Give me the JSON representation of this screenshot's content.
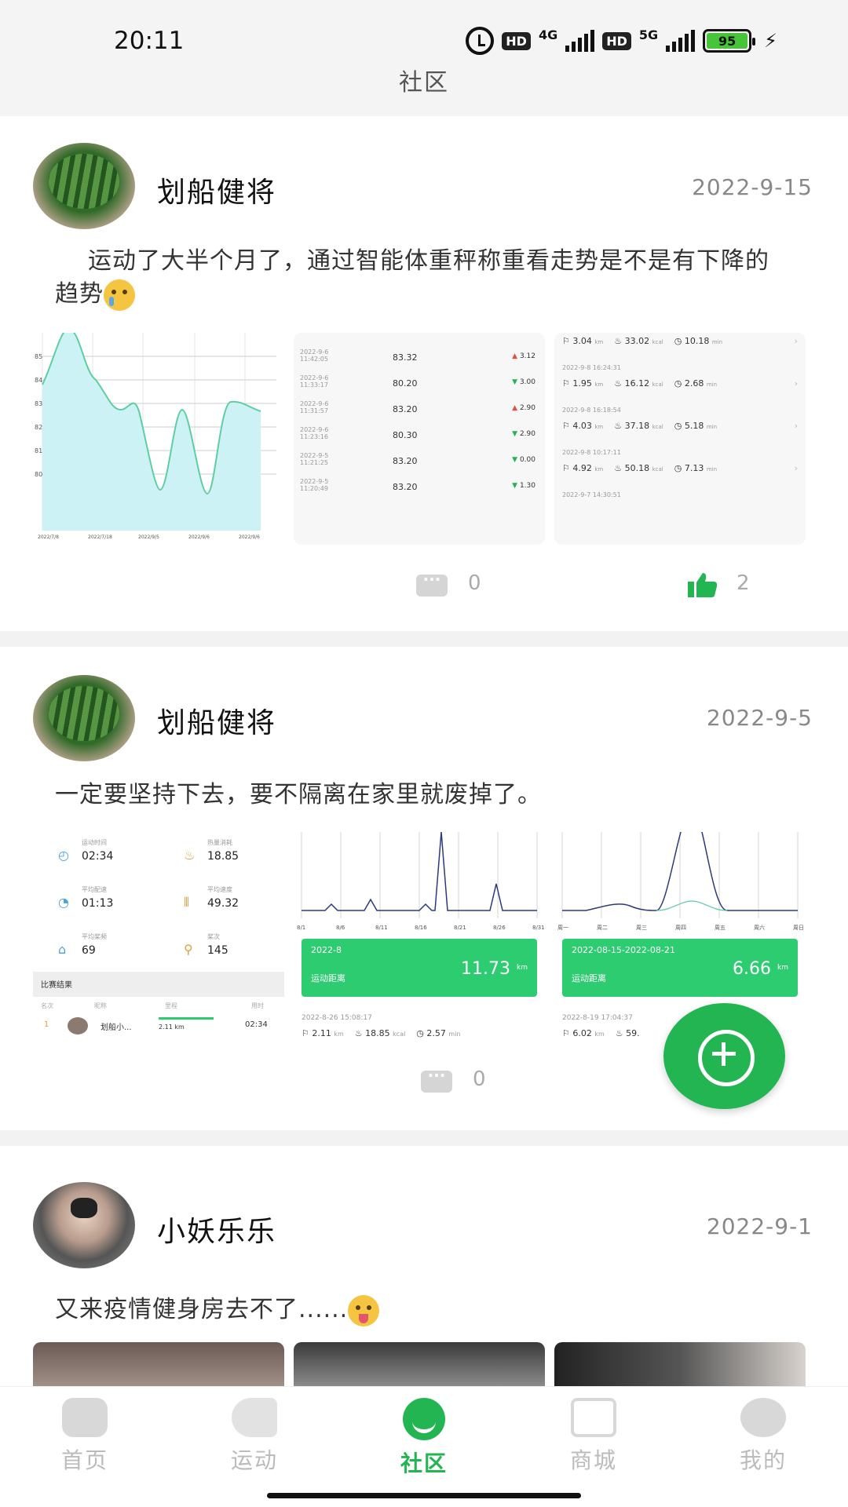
{
  "status": {
    "time": "20:11",
    "hd": "HD",
    "net1": "4G",
    "net2": "5G",
    "battery": "95"
  },
  "header": {
    "title": "社区"
  },
  "posts": [
    {
      "user": "划船健将",
      "date": "2022-9-15",
      "text": "运动了大半个月了，通过智能体重秤称重看走势是不是有下降的趋势",
      "comments": "0",
      "likes": "2",
      "chart": {
        "y_ticks": [
          "85",
          "84",
          "83",
          "82",
          "81",
          "80"
        ],
        "x_ticks": [
          "2022/7/8",
          "2022/7/18",
          "2022/9/5",
          "2022/9/6",
          "2022/9/6"
        ]
      },
      "records": [
        {
          "date": "2022-9-6",
          "time": "11:42:05",
          "weight": "83.32",
          "diff": "3.12",
          "up": true
        },
        {
          "date": "2022-9-6",
          "time": "11:33:17",
          "weight": "80.20",
          "diff": "3.00",
          "up": false
        },
        {
          "date": "2022-9-6",
          "time": "11:31:57",
          "weight": "83.20",
          "diff": "2.90",
          "up": true
        },
        {
          "date": "2022-9-6",
          "time": "11:23:16",
          "weight": "80.30",
          "diff": "2.90",
          "up": false
        },
        {
          "date": "2022-9-5",
          "time": "11:21:25",
          "weight": "83.20",
          "diff": "0.00",
          "up": false
        },
        {
          "date": "2022-9-5",
          "time": "11:20:49",
          "weight": "83.20",
          "diff": "1.30",
          "up": false
        }
      ],
      "sessions": [
        {
          "ts": "",
          "km": "3.04",
          "kcal": "33.02",
          "min": "10.18"
        },
        {
          "ts": "2022-9-8 16:24:31",
          "km": "1.95",
          "kcal": "16.12",
          "min": "2.68"
        },
        {
          "ts": "2022-9-8 16:18:54",
          "km": "4.03",
          "kcal": "37.18",
          "min": "5.18"
        },
        {
          "ts": "2022-9-8 10:17:11",
          "km": "4.92",
          "kcal": "50.18",
          "min": "7.13"
        },
        {
          "ts": "2022-9-7 14:30:51",
          "km": "",
          "kcal": "",
          "min": ""
        }
      ]
    },
    {
      "user": "划船健将",
      "date": "2022-9-5",
      "text": "一定要坚持下去，要不隔离在家里就废掉了。",
      "comments": "0",
      "stats": [
        {
          "label": "运动时间",
          "value": "02:34"
        },
        {
          "label": "热量消耗",
          "value": "18.85"
        },
        {
          "label": "平均配速",
          "value": "01:13"
        },
        {
          "label": "平均速度",
          "value": "49.32"
        },
        {
          "label": "平均桨频",
          "value": "69"
        },
        {
          "label": "桨次",
          "value": "145"
        }
      ],
      "match": {
        "title": "比赛结果",
        "cols": [
          "名次",
          "昵称",
          "里程",
          "用时"
        ],
        "row": {
          "rank": "1",
          "name": "划船小...",
          "dist": "2.11 km",
          "time": "02:34"
        }
      },
      "month_card": {
        "period": "2022-8",
        "label": "运动距离",
        "value": "11.73",
        "unit": "km",
        "ts": "2022-8-26 15:08:17",
        "km": "2.11",
        "kcal": "18.85",
        "min": "2.57"
      },
      "week_card": {
        "period": "2022-08-15-2022-08-21",
        "label": "运动距离",
        "value": "6.66",
        "unit": "km",
        "ts": "2022-8-19 17:04:37",
        "km": "6.02",
        "kcal": "59."
      },
      "month_x": [
        "8/1",
        "8/6",
        "8/11",
        "8/16",
        "8/21",
        "8/26",
        "8/31"
      ],
      "week_x": [
        "周一",
        "周二",
        "周三",
        "周四",
        "周五",
        "周六",
        "周日"
      ]
    },
    {
      "user": "小妖乐乐",
      "date": "2022-9-1",
      "text": "又来疫情健身房去不了......"
    }
  ],
  "nav": [
    {
      "label": "首页"
    },
    {
      "label": "运动"
    },
    {
      "label": "社区"
    },
    {
      "label": "商城"
    },
    {
      "label": "我的"
    }
  ],
  "colors": {
    "accent": "#23b552",
    "up": "#e74c3c",
    "down": "#23b552"
  }
}
